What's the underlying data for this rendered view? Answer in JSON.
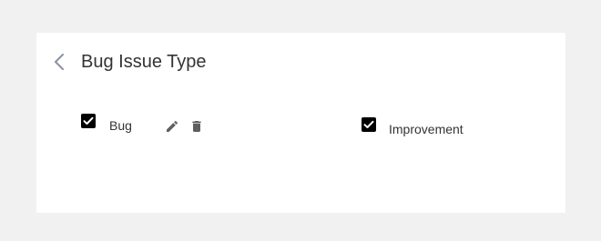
{
  "header": {
    "title": "Bug Issue Type",
    "back_icon": "chevron-left-icon"
  },
  "options": [
    {
      "label": "Bug",
      "checked": true,
      "actions": [
        "edit-icon",
        "delete-icon"
      ]
    },
    {
      "label": "Improvement",
      "checked": true
    }
  ],
  "colors": {
    "background": "#f1f1f1",
    "panel": "#ffffff",
    "text": "#333333",
    "checkbox": "#000000",
    "icon": "#5f5f5f",
    "back_icon": "#8f97a6"
  }
}
